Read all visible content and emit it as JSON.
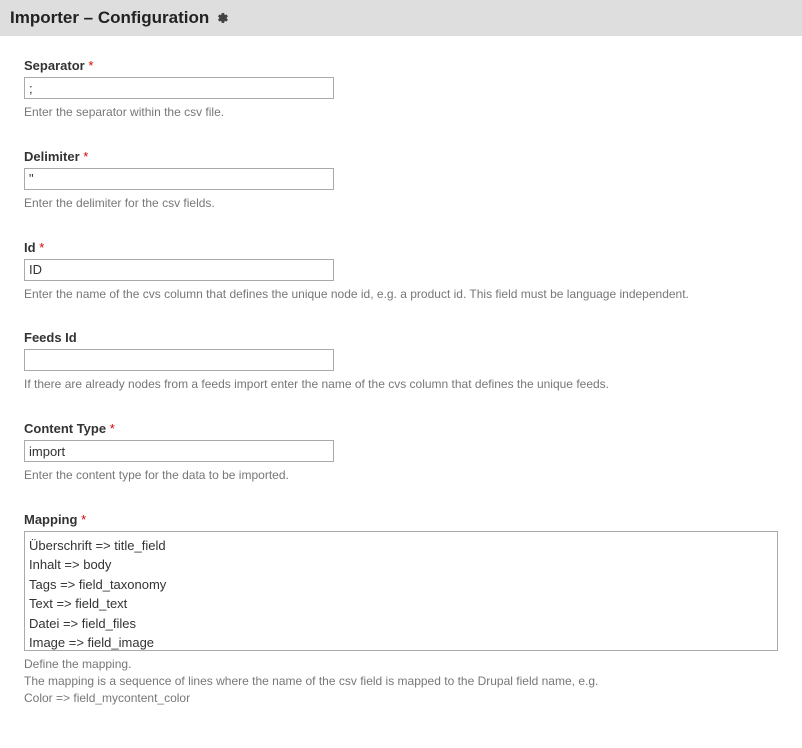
{
  "header": {
    "title": "Importer – Configuration"
  },
  "form": {
    "separator": {
      "label": "Separator",
      "required": "*",
      "value": ";",
      "help": "Enter the separator within the csv file."
    },
    "delimiter": {
      "label": "Delimiter",
      "required": "*",
      "value": "\"",
      "help": "Enter the delimiter for the csv fields."
    },
    "id": {
      "label": "Id",
      "required": "*",
      "value": "ID",
      "help": "Enter the name of the cvs column that defines the unique node id, e.g. a product id. This field must be language independent."
    },
    "feeds_id": {
      "label": "Feeds Id",
      "value": "",
      "help": "If there are already nodes from a feeds import enter the name of the cvs column that defines the unique feeds."
    },
    "content_type": {
      "label": "Content Type",
      "required": "*",
      "value": "import",
      "help": "Enter the content type for the data to be imported."
    },
    "mapping": {
      "label": "Mapping",
      "required": "*",
      "value": "Überschrift => title_field\nInhalt => body\nTags => field_taxonomy\nText => field_text\nDatei => field_files\nImage => field_image",
      "help_line1": "Define the mapping.",
      "help_line2": "The mapping is a sequence of lines where the name of the csv field is mapped to the Drupal field name, e.g.",
      "help_line3": "Color => field_mycontent_color"
    }
  }
}
